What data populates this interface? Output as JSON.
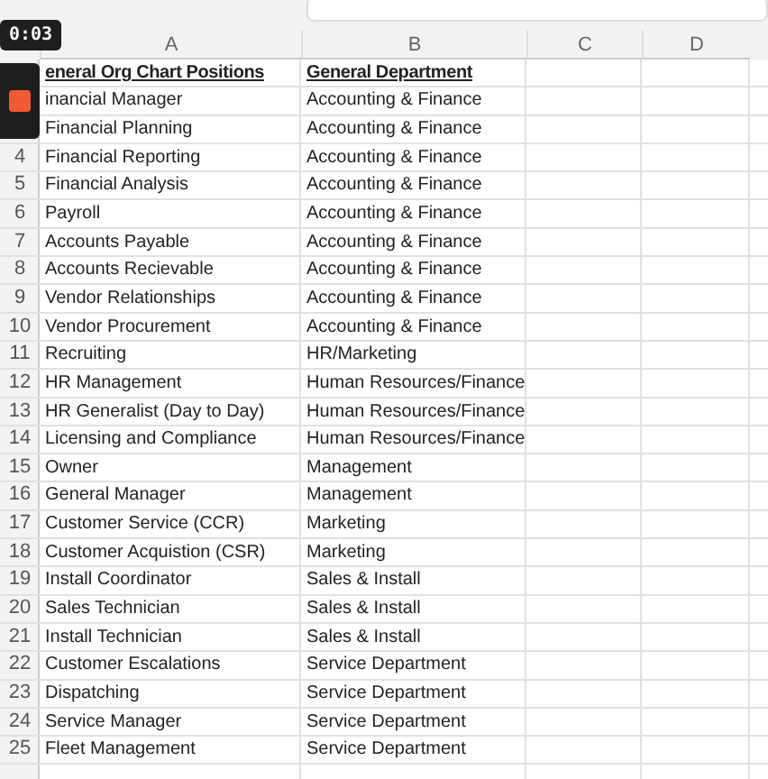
{
  "recording": {
    "elapsed": "0:03"
  },
  "columns": [
    "A",
    "B",
    "C",
    "D"
  ],
  "rows": [
    {
      "kind": "header",
      "a": "eneral Org Chart Positions",
      "b": "General Department"
    },
    {
      "kind": "data",
      "a": "inancial Manager",
      "b": "Accounting & Finance"
    },
    {
      "kind": "data",
      "a": "Financial Planning",
      "b": "Accounting & Finance"
    },
    {
      "kind": "data",
      "num": "4",
      "a": "Financial Reporting",
      "b": "Accounting & Finance"
    },
    {
      "kind": "data",
      "num": "5",
      "a": "Financial Analysis",
      "b": "Accounting & Finance"
    },
    {
      "kind": "data",
      "num": "6",
      "a": "Payroll",
      "b": "Accounting & Finance"
    },
    {
      "kind": "data",
      "num": "7",
      "a": "Accounts Payable",
      "b": "Accounting & Finance"
    },
    {
      "kind": "data",
      "num": "8",
      "a": "Accounts Recievable",
      "b": "Accounting & Finance"
    },
    {
      "kind": "data",
      "num": "9",
      "a": "Vendor Relationships",
      "b": "Accounting & Finance"
    },
    {
      "kind": "data",
      "num": "10",
      "a": "Vendor Procurement",
      "b": "Accounting & Finance"
    },
    {
      "kind": "data",
      "num": "11",
      "a": "Recruiting",
      "b": "HR/Marketing"
    },
    {
      "kind": "data",
      "num": "12",
      "a": "HR Management",
      "b": "Human Resources/Finance"
    },
    {
      "kind": "data",
      "num": "13",
      "a": "HR Generalist (Day to Day)",
      "b": "Human Resources/Finance"
    },
    {
      "kind": "data",
      "num": "14",
      "a": "Licensing and Compliance",
      "b": "Human Resources/Finance"
    },
    {
      "kind": "data",
      "num": "15",
      "a": "Owner",
      "b": "Management"
    },
    {
      "kind": "data",
      "num": "16",
      "a": "General Manager",
      "b": "Management"
    },
    {
      "kind": "data",
      "num": "17",
      "a": "Customer Service (CCR)",
      "b": "Marketing"
    },
    {
      "kind": "data",
      "num": "18",
      "a": "Customer Acquistion (CSR)",
      "b": "Marketing"
    },
    {
      "kind": "data",
      "num": "19",
      "a": "Install Coordinator",
      "b": "Sales & Install"
    },
    {
      "kind": "data",
      "num": "20",
      "a": "Sales Technician",
      "b": "Sales & Install"
    },
    {
      "kind": "data",
      "num": "21",
      "a": "Install Technician",
      "b": "Sales & Install"
    },
    {
      "kind": "data",
      "num": "22",
      "a": "Customer Escalations",
      "b": "Service Department"
    },
    {
      "kind": "data",
      "num": "23",
      "a": "Dispatching",
      "b": "Service Department"
    },
    {
      "kind": "data",
      "num": "24",
      "a": "Service Manager",
      "b": "Service Department"
    },
    {
      "kind": "data",
      "num": "25",
      "a": "Fleet Management",
      "b": "Service Department"
    }
  ]
}
